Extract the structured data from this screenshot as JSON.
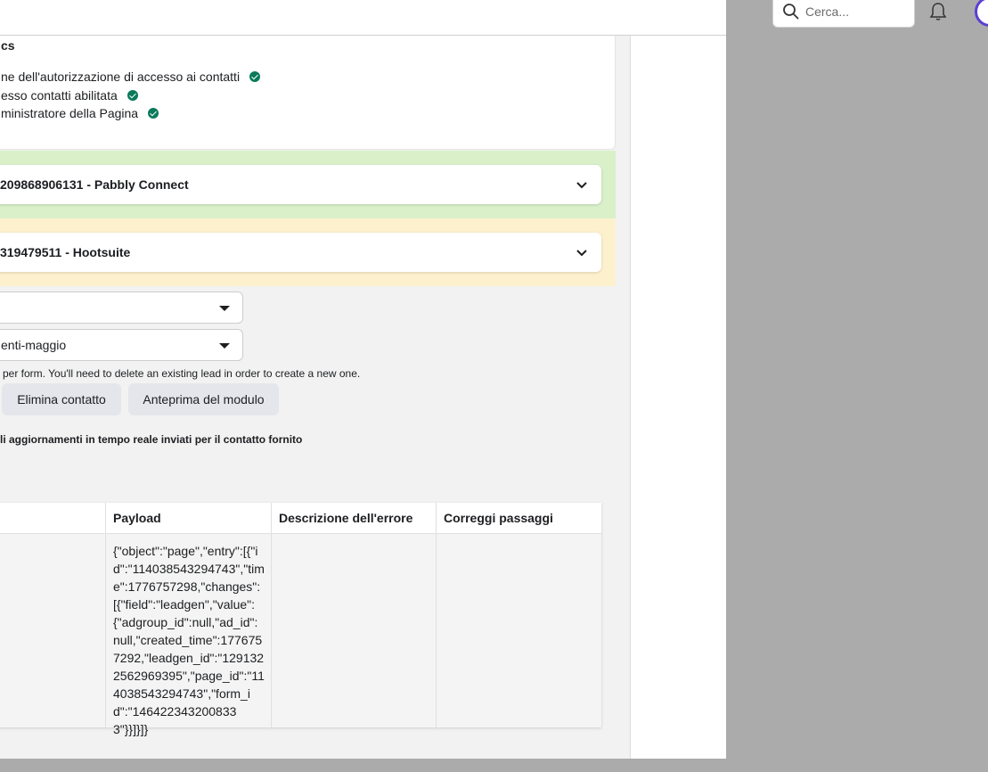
{
  "header": {
    "search_placeholder": "Cerca..."
  },
  "permissions": {
    "title": "cs",
    "items": [
      {
        "label": "ne dell'autorizzazione di accesso ai contatti"
      },
      {
        "label": "esso contatti abilitata"
      },
      {
        "label": "ministratore della Pagina"
      }
    ]
  },
  "integrations": [
    {
      "label": "209868906131 - Pabbly Connect",
      "status_color": "#d9f0c9"
    },
    {
      "label": "319479511 - Hootsuite",
      "status_color": "#fdf1cd"
    }
  ],
  "selects": {
    "page_value": "",
    "form_value": "enti-maggio"
  },
  "note": "per form. You'll need to delete an existing lead in order to create a new one.",
  "buttons": {
    "delete_label": "Elimina contatto",
    "preview_label": "Anteprima del modulo"
  },
  "updates_title": "li aggiornamenti in tempo reale inviati per il contatto fornito",
  "table": {
    "columns": [
      "Payload",
      "Descrizione dell'errore",
      "Correggi passaggi"
    ],
    "rows": [
      {
        "payload": "{\"object\":\"page\",\"entry\":[{\"id\":\"114038543294743\",\"time\":1776757298,\"changes\":[{\"field\":\"leadgen\",\"value\":{\"adgroup_id\":null,\"ad_id\":null,\"created_time\":1776757292,\"leadgen_id\":\"1291322562969395\",\"page_id\":\"114038543294743\",\"form_id\":\"1464223432008333\"}}]}]}",
        "error": "",
        "fix": ""
      }
    ]
  },
  "colors": {
    "check": "#0a7a5a",
    "accent": "#5b3fd4"
  }
}
